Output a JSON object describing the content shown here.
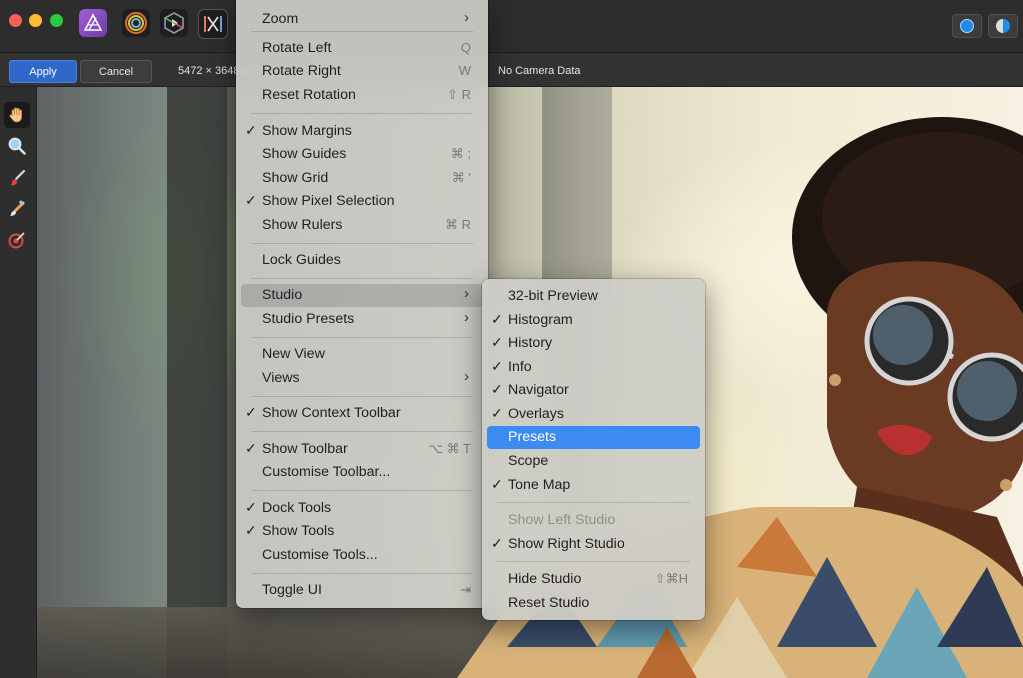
{
  "titlebar": {
    "personas": [
      "photo-persona",
      "liquify-persona",
      "develop-persona",
      "tone-mapping-persona"
    ]
  },
  "context_toolbar": {
    "apply_label": "Apply",
    "cancel_label": "Cancel",
    "dimensions": "5472 × 3648px",
    "camera": "No Camera Data"
  },
  "tools": [
    "hand-tool",
    "zoom-tool",
    "brush-tool",
    "selection-brush-tool",
    "white-balance-tool"
  ],
  "view_menu": {
    "zoom": "Zoom",
    "rotate_left": "Rotate Left",
    "rotate_left_sc": "Q",
    "rotate_right": "Rotate Right",
    "rotate_right_sc": "W",
    "reset_rotation": "Reset Rotation",
    "reset_rotation_sc": "⇧ R",
    "show_margins": "Show Margins",
    "show_guides": "Show Guides",
    "show_guides_sc": "⌘ ;",
    "show_grid": "Show Grid",
    "show_grid_sc": "⌘ '",
    "show_pixel_selection": "Show Pixel Selection",
    "show_rulers": "Show Rulers",
    "show_rulers_sc": "⌘ R",
    "lock_guides": "Lock Guides",
    "studio": "Studio",
    "studio_presets": "Studio Presets",
    "new_view": "New View",
    "views": "Views",
    "show_context_toolbar": "Show Context Toolbar",
    "show_toolbar": "Show Toolbar",
    "show_toolbar_sc": "⌥ ⌘ T",
    "customise_toolbar": "Customise Toolbar...",
    "dock_tools": "Dock Tools",
    "show_tools": "Show Tools",
    "customise_tools": "Customise Tools...",
    "toggle_ui": "Toggle UI",
    "toggle_ui_sc": "⇥"
  },
  "studio_menu": {
    "preview_32bit": "32-bit Preview",
    "histogram": "Histogram",
    "history": "History",
    "info": "Info",
    "navigator": "Navigator",
    "overlays": "Overlays",
    "presets": "Presets",
    "scope": "Scope",
    "tone_map": "Tone Map",
    "show_left_studio": "Show Left Studio",
    "show_right_studio": "Show Right Studio",
    "hide_studio": "Hide Studio",
    "hide_studio_sc": "⇧⌘H",
    "reset_studio": "Reset Studio"
  },
  "check": "✓",
  "arrow": "›"
}
